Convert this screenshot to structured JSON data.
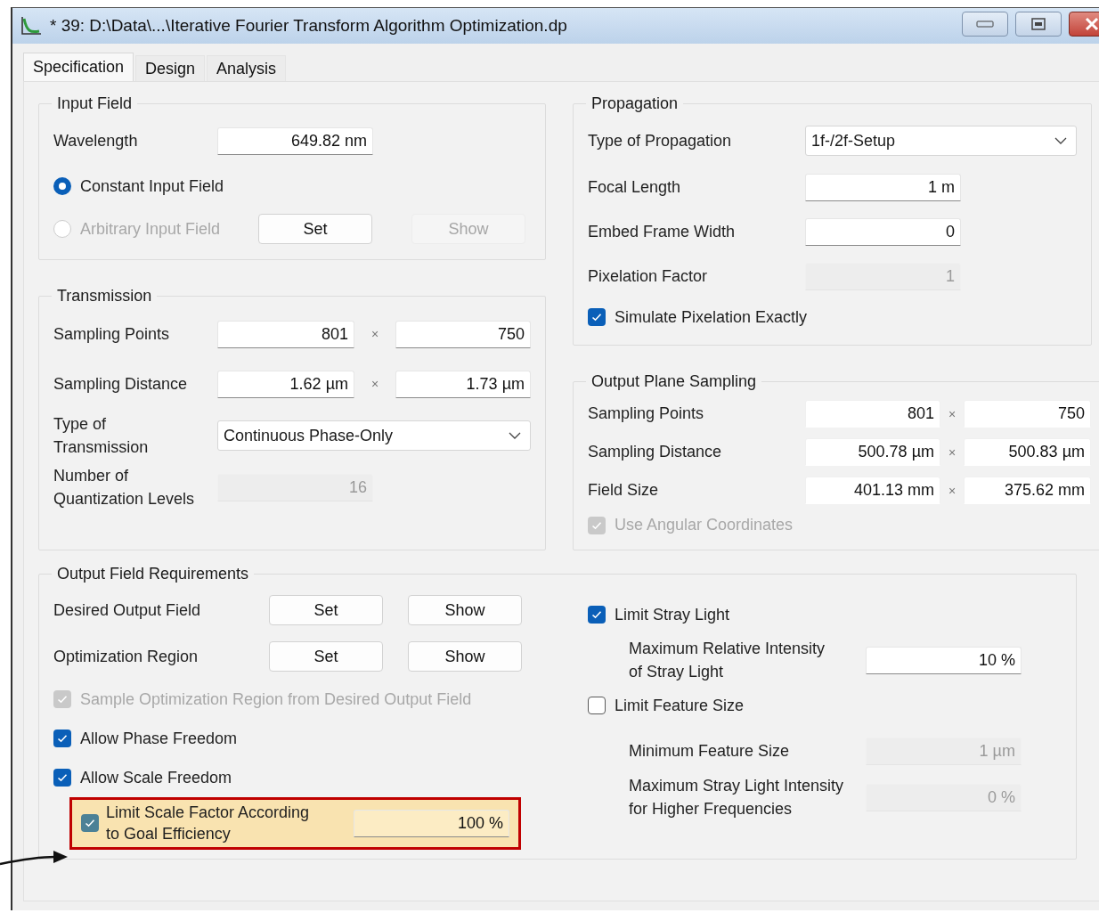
{
  "window": {
    "title": "* 39: D:\\Data\\...\\Iterative Fourier Transform Algorithm Optimization.dp"
  },
  "tabs": [
    {
      "label": "Specification",
      "selected": true
    },
    {
      "label": "Design",
      "selected": false
    },
    {
      "label": "Analysis",
      "selected": false
    }
  ],
  "input_field": {
    "title": "Input Field",
    "rows": [
      {
        "kind": "field",
        "label": "Wavelength",
        "value": "649.82 nm",
        "disabled": false
      },
      {
        "kind": "radio",
        "label": "Constant Input Field",
        "selected": true,
        "disabled": false
      },
      {
        "kind": "radio",
        "label": "Arbitrary Input Field",
        "selected": false,
        "disabled": true,
        "buttons": [
          {
            "label": "Set",
            "disabled": false
          },
          {
            "label": "Show",
            "disabled": true
          }
        ]
      }
    ]
  },
  "transmission": {
    "title": "Transmission",
    "rows": [
      {
        "kind": "pair",
        "label": "Sampling Points",
        "values": [
          "801",
          "750"
        ],
        "separator": "×"
      },
      {
        "kind": "pair",
        "label": "Sampling Distance",
        "values": [
          "1.62 µm",
          "1.73 µm"
        ],
        "separator": "×"
      },
      {
        "kind": "dropdown",
        "label": "Type of\nTransmission",
        "value": "Continuous Phase-Only"
      },
      {
        "kind": "field",
        "label": "Number of\nQuantization Levels",
        "value": "16",
        "disabled": true
      }
    ]
  },
  "propagation": {
    "title": "Propagation",
    "rows": [
      {
        "kind": "dropdown",
        "label": "Type of Propagation",
        "value": "1f-/2f-Setup"
      },
      {
        "kind": "field",
        "label": "Focal Length",
        "value": "1 m",
        "disabled": false
      },
      {
        "kind": "field",
        "label": "Embed Frame Width",
        "value": "0",
        "disabled": false
      },
      {
        "kind": "field",
        "label": "Pixelation Factor",
        "value": "1",
        "disabled": true
      },
      {
        "kind": "checkbox",
        "label": "Simulate Pixelation Exactly",
        "checked": true,
        "disabled": false
      }
    ]
  },
  "output_plane_sampling": {
    "title": "Output Plane Sampling",
    "read_only": true,
    "rows": [
      {
        "kind": "pair",
        "label": "Sampling Points",
        "values": [
          "801",
          "750"
        ],
        "separator": "×"
      },
      {
        "kind": "pair",
        "label": "Sampling Distance",
        "values": [
          "500.78 µm",
          "500.83 µm"
        ],
        "separator": "×"
      },
      {
        "kind": "pair",
        "label": "Field Size",
        "values": [
          "401.13 mm",
          "375.62 mm"
        ],
        "separator": "×"
      },
      {
        "kind": "checkbox",
        "label": "Use Angular Coordinates",
        "checked": true,
        "disabled": true
      }
    ]
  },
  "output_field_requirements": {
    "title": "Output Field Requirements",
    "left": [
      {
        "kind": "buttons",
        "label": "Desired Output Field",
        "buttons": [
          {
            "label": "Set",
            "disabled": false
          },
          {
            "label": "Show",
            "disabled": false
          }
        ]
      },
      {
        "kind": "buttons",
        "label": "Optimization Region",
        "buttons": [
          {
            "label": "Set",
            "disabled": false
          },
          {
            "label": "Show",
            "disabled": false
          }
        ]
      },
      {
        "kind": "checkbox",
        "label": "Sample Optimization Region from Desired Output Field",
        "checked": true,
        "disabled": true
      },
      {
        "kind": "checkbox",
        "label": "Allow Phase Freedom",
        "checked": true,
        "disabled": false
      },
      {
        "kind": "checkbox",
        "label": "Allow Scale Freedom",
        "checked": true,
        "disabled": false,
        "children": [
          {
            "kind": "checkbox_field",
            "label": "Limit Scale Factor According\nto Goal Efficiency",
            "checked": true,
            "disabled": false,
            "value": "100 %",
            "highlighted": true
          }
        ]
      }
    ],
    "right": [
      {
        "kind": "checkbox",
        "label": "Limit Stray Light",
        "checked": true,
        "disabled": false,
        "children": [
          {
            "kind": "field",
            "label": "Maximum Relative Intensity\nof Stray Light",
            "value": "10 %",
            "disabled": false
          }
        ]
      },
      {
        "kind": "checkbox",
        "label": "Limit Feature Size",
        "checked": false,
        "disabled": false,
        "children": [
          {
            "kind": "field",
            "label": "Minimum Feature Size",
            "value": "1 µm",
            "disabled": true
          },
          {
            "kind": "field",
            "label": "Maximum Stray Light Intensity\nfor Higher Frequencies",
            "value": "0 %",
            "disabled": true
          }
        ]
      }
    ]
  }
}
